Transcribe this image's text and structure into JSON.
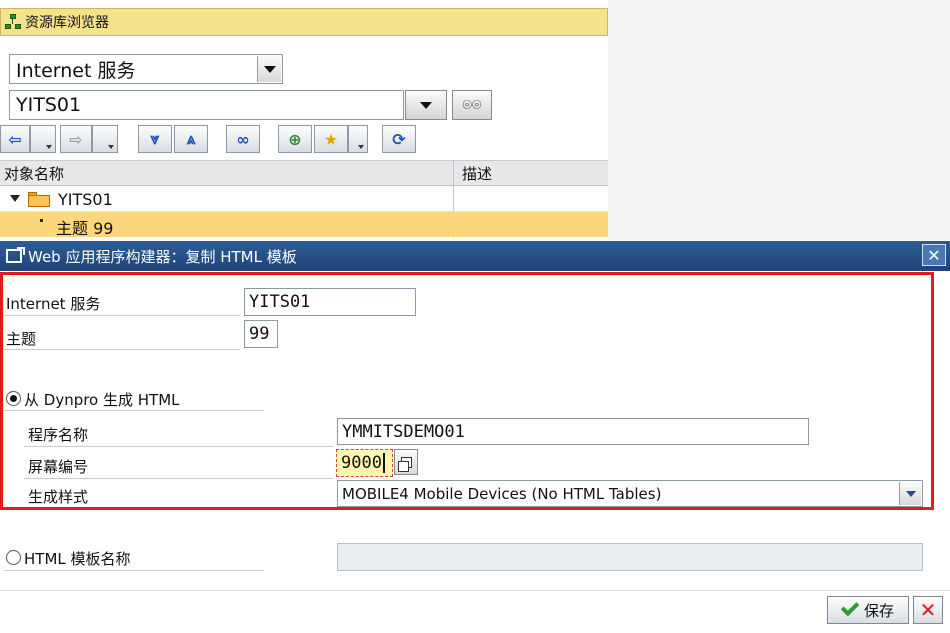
{
  "browser": {
    "title": "资源库浏览器",
    "object_type": "Internet 服务",
    "object_name": "YITS01",
    "display_icon": "glasses-icon",
    "toolbar": [
      {
        "name": "back-button",
        "icon": "arrow-left-icon",
        "glyph": "⇦"
      },
      {
        "name": "forward-button",
        "icon": "arrow-right-icon",
        "glyph": "⇨"
      },
      {
        "name": "expand-down-button",
        "icon": "expand-down-icon",
        "glyph": "⩔"
      },
      {
        "name": "collapse-up-button",
        "icon": "collapse-up-icon",
        "glyph": "⩓"
      },
      {
        "name": "find-button",
        "icon": "binoculars-icon",
        "glyph": "⊞"
      },
      {
        "name": "hierarchy-button",
        "icon": "hierarchy-icon",
        "glyph": "⊕"
      },
      {
        "name": "favorites-button",
        "icon": "star-icon",
        "glyph": "★"
      },
      {
        "name": "refresh-button",
        "icon": "refresh-icon",
        "glyph": "⟳"
      }
    ],
    "tree": {
      "columns": [
        "对象名称",
        "描述"
      ],
      "rows": [
        {
          "label": "YITS01",
          "icon": "folder-icon",
          "expanded": true
        },
        {
          "label": "主题 99",
          "selected": true
        }
      ]
    }
  },
  "dialog": {
    "title": "Web 应用程序构建器：复制 HTML 模板",
    "close_icon": "close-icon",
    "service_label": "Internet 服务",
    "service_value": "YITS01",
    "theme_label": "主题",
    "theme_value": "99",
    "option_dynpro": "从 Dynpro 生成 HTML",
    "program_label": "程序名称",
    "program_value": "YMMITSDEMO01",
    "screen_label": "屏幕编号",
    "screen_value": "9000",
    "style_label": "生成样式",
    "style_value": "MOBILE4 Mobile Devices (No HTML Tables)",
    "option_template": "HTML 模板名称",
    "template_value": "",
    "save_label": "保存",
    "accent_color": "#e51b1b",
    "titlebar_color": "#2e5d96"
  }
}
